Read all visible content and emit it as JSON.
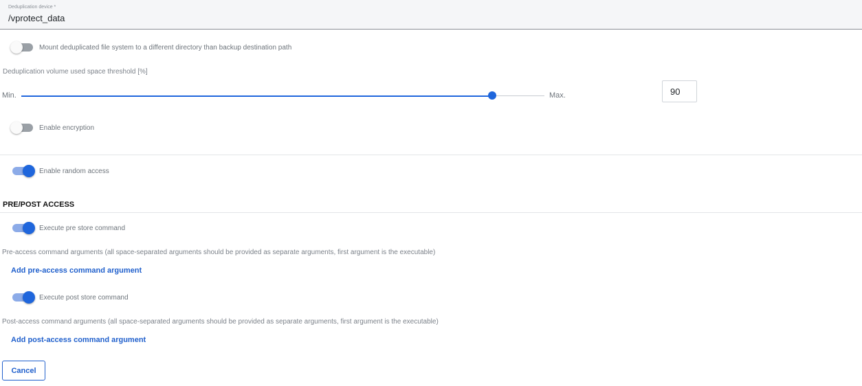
{
  "dedup_device": {
    "label": "Deduplication device *",
    "value": "/vprotect_data"
  },
  "toggles": {
    "mount_dedup": {
      "label": "Mount deduplicated file system to a different directory than backup destination path",
      "on": false
    },
    "encryption": {
      "label": "Enable encryption",
      "on": false
    },
    "random_access": {
      "label": "Enable random access",
      "on": true
    },
    "pre_store": {
      "label": "Execute pre store command",
      "on": true
    },
    "post_store": {
      "label": "Execute post store command",
      "on": true
    }
  },
  "threshold": {
    "label": "Deduplication volume used space threshold [%]",
    "min_label": "Min.",
    "max_label": "Max.",
    "value": "90",
    "min": 0,
    "max": 100
  },
  "pre_post": {
    "section_title": "PRE/POST ACCESS",
    "pre_args_text": "Pre-access command arguments (all space-separated arguments should be provided as separate arguments, first argument is the executable)",
    "add_pre_label": "Add pre-access command argument",
    "post_args_text": "Post-access command arguments (all space-separated arguments should be provided as separate arguments, first argument is the executable)",
    "add_post_label": "Add post-access command argument"
  },
  "actions": {
    "cancel_label": "Cancel"
  },
  "colors": {
    "accent": "#1f66dc",
    "toggle_on_track": "#8cabe8",
    "toggle_off_track": "#9aa0a6",
    "link": "#1f5fcc"
  }
}
